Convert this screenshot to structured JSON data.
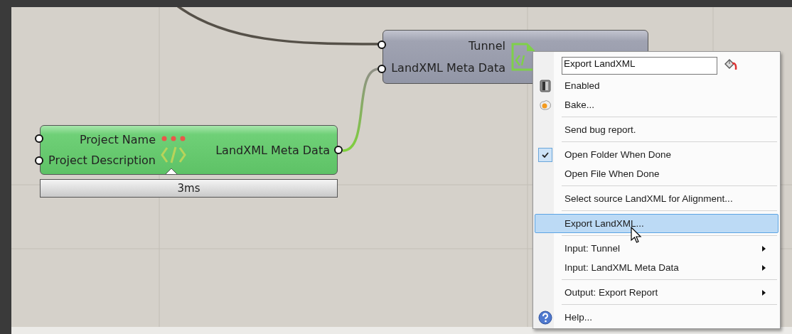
{
  "nodes": [
    {
      "selected": false,
      "inputs": [
        "Tunnel",
        "LandXML Meta Data"
      ]
    },
    {
      "selected": true,
      "inputs": [
        "Project Name",
        "Project Description"
      ],
      "outputs": [
        "LandXML Meta Data"
      ],
      "messages": true,
      "profiler": "3ms"
    }
  ],
  "context_menu": {
    "items": [
      {
        "kind": "field",
        "value": "Export LandXML"
      },
      {
        "kind": "enable",
        "label": "Enabled",
        "selected": false
      },
      {
        "kind": "bake",
        "label": "Bake...",
        "selected": false
      },
      {
        "kind": "separator"
      },
      {
        "kind": "item",
        "label": "Send bug report.",
        "selected": false
      },
      {
        "kind": "separator"
      },
      {
        "kind": "check",
        "label": "Open Folder When Done",
        "checked": true,
        "selected": false
      },
      {
        "kind": "check",
        "label": "Open File When Done",
        "checked": false,
        "selected": false
      },
      {
        "kind": "separator"
      },
      {
        "kind": "item",
        "label": "Select source LandXML for Alignment...",
        "selected": false
      },
      {
        "kind": "separator"
      },
      {
        "kind": "item",
        "label": "Export LandXML...",
        "selected": true
      },
      {
        "kind": "separator"
      },
      {
        "kind": "submenu",
        "label": "Input: Tunnel",
        "selected": false
      },
      {
        "kind": "submenu",
        "label": "Input: LandXML Meta Data",
        "selected": false
      },
      {
        "kind": "separator"
      },
      {
        "kind": "submenu",
        "label": "Output: Export Report",
        "selected": false
      },
      {
        "kind": "separator"
      },
      {
        "kind": "help",
        "label": "Help...",
        "selected": false
      }
    ]
  }
}
